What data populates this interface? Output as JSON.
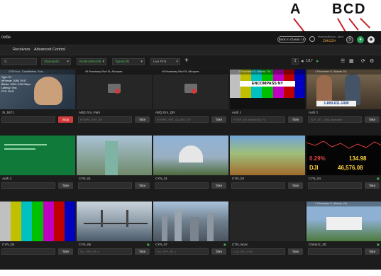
{
  "callouts": {
    "a": "A",
    "b": "B",
    "c": "C",
    "d": "D"
  },
  "topbar": {
    "brand": "ovbe",
    "back_button": "Back to Classic UI",
    "user_line": "rfrancis@dow...(dow",
    "user_code": "ZHK2ZH",
    "help": "?",
    "status": "●",
    "avatar": "◉"
  },
  "nav": {
    "items": [
      "Receivers",
      "Advanced Control"
    ]
  },
  "toolbar": {
    "search_placeholder": "Q",
    "filter_1": "Status(All)",
    "filter_2": "Bookmarks(All)",
    "filter_3": "Types(All)",
    "filter_4": "Live First",
    "add": "+",
    "page_current": "1",
    "page_total": "1/17",
    "prev": "◂",
    "next": "▸",
    "list_view": "☰",
    "grid_view": "▦",
    "refresh": "⟳",
    "settings": "⚙"
  },
  "tiles": [
    {
      "loc": "1700 Acu...Constitution, Sca...",
      "name": "SI_5571",
      "stream": "",
      "btn": "Stop",
      "red": true,
      "status": "",
      "video": "news"
    },
    {
      "loc": "49 Broadway Blvd St, Albuquer...",
      "name": "ABQ Grn_Park",
      "stream": "RTMPS_SRT_Mr",
      "btn": "Take",
      "red": false,
      "status": "",
      "video": "empty"
    },
    {
      "loc": "49 Broadway Blvd St, Albuquer...",
      "name": "ABQ Grn_QR",
      "stream": "RTMPS_SRT_QLUBS_SR",
      "btn": "Take",
      "red": false,
      "status": "",
      "video": "empty"
    },
    {
      "loc": "1 Peachtree S, Atlanta, GA",
      "name": "Auth 1",
      "stream": "RTMP_ATLSimpleGe_Fu",
      "btn": "Take",
      "red": false,
      "status": "",
      "video": "smpte"
    },
    {
      "loc": "1 Peachtree S, Atlanta GA",
      "name": "Auth 2",
      "stream": "TCP_ATL_Tidy_Nhaubce",
      "btn": "Take",
      "red": false,
      "status": "",
      "video": "studio"
    },
    {
      "loc": "",
      "name": "Auth 3",
      "stream": "",
      "btn": "Take",
      "red": false,
      "status": "",
      "video": "green"
    },
    {
      "loc": "",
      "name": "CYN_01",
      "stream": "",
      "btn": "Take",
      "red": false,
      "status": "",
      "video": "statue"
    },
    {
      "loc": "",
      "name": "CYN_01",
      "stream": "",
      "btn": "Take",
      "red": false,
      "status": "",
      "video": "capitol"
    },
    {
      "loc": "",
      "name": "CYN_03",
      "stream": "",
      "btn": "Take",
      "red": false,
      "status": "",
      "video": "trees"
    },
    {
      "loc": "",
      "name": "CYN_04",
      "stream": "",
      "btn": "Take",
      "red": false,
      "status": "▣",
      "video": "ticker"
    },
    {
      "loc": "",
      "name": "CYN_05",
      "stream": "",
      "btn": "Take",
      "red": false,
      "status": "",
      "video": "bars"
    },
    {
      "loc": "",
      "name": "CYN_06",
      "stream": "SLI_SFP_5P_4",
      "btn": "Take",
      "red": false,
      "status": "▣",
      "video": "bridge"
    },
    {
      "loc": "",
      "name": "CYN_07",
      "stream": "SLI_SFP_5P_7",
      "btn": "Take",
      "red": false,
      "status": "▣",
      "video": "city"
    },
    {
      "loc": "",
      "name": "CYN_Ncec",
      "stream": "LCD_SFI_CYN",
      "btn": "Take",
      "red": false,
      "status": "",
      "video": "empty2"
    },
    {
      "loc": "1 Peachtree S, Atlanta, GA",
      "name": "CNNuzz_3D",
      "stream": "",
      "btn": "Take",
      "red": false,
      "status": "▣",
      "video": "whitehouse"
    }
  ],
  "video_text": {
    "encompass": "ENCOMPASS NY",
    "phone": "1-800-611-1400",
    "ticker_pct": "0.29%",
    "ticker_val": "134.98",
    "ticker_dji": "DJI",
    "ticker_big": "46,576.08",
    "news_lines": [
      "Type: ST",
      "InFormat: 1080i 29.97",
      "Bitrate: 1000 / 1000 Mbps",
      "Latency: 0ms",
      "FPS: 29.97"
    ]
  }
}
